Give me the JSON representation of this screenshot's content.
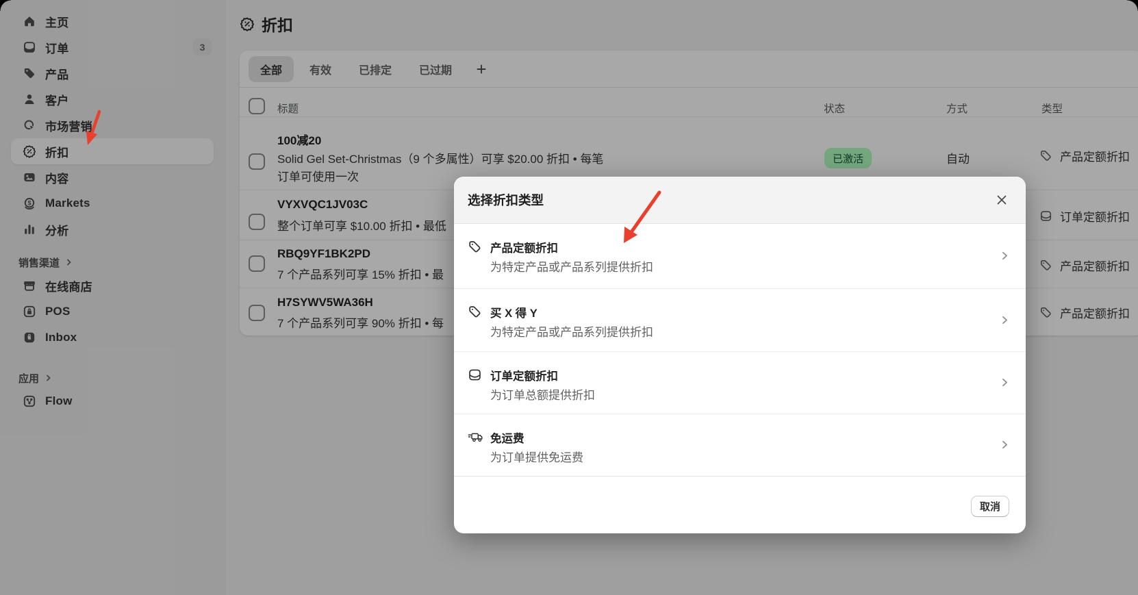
{
  "page": {
    "title": "折扣"
  },
  "sidebar": {
    "items": [
      {
        "label": "主页",
        "icon": "home-icon"
      },
      {
        "label": "订单",
        "icon": "orders-icon",
        "badge": "3"
      },
      {
        "label": "产品",
        "icon": "products-tag-icon"
      },
      {
        "label": "客户",
        "icon": "customers-icon"
      },
      {
        "label": "市场营销",
        "icon": "marketing-icon"
      },
      {
        "label": "折扣",
        "icon": "discounts-icon",
        "active": true
      },
      {
        "label": "内容",
        "icon": "content-icon"
      },
      {
        "label": "Markets",
        "icon": "markets-icon"
      },
      {
        "label": "分析",
        "icon": "analytics-icon"
      }
    ],
    "sections": [
      {
        "header": "销售渠道",
        "items": [
          {
            "label": "在线商店",
            "icon": "online-store-icon"
          },
          {
            "label": "POS",
            "icon": "pos-icon"
          },
          {
            "label": "Inbox",
            "icon": "inbox-icon"
          }
        ]
      },
      {
        "header": "应用",
        "items": [
          {
            "label": "Flow",
            "icon": "flow-icon"
          }
        ]
      }
    ]
  },
  "tabs": {
    "items": [
      "全部",
      "有效",
      "已排定",
      "已过期"
    ],
    "active": "全部",
    "add_label": "+"
  },
  "table": {
    "columns": {
      "title": "标题",
      "status": "状态",
      "method": "方式",
      "type": "类型"
    },
    "rows": [
      {
        "title": "100减20",
        "desc": "Solid Gel Set-Christmas（9 个多属性）可享 $20.00 折扣 • 每笔",
        "desc2": "订单可使用一次",
        "status": "已激活",
        "method": "自动",
        "type": "产品定额折扣",
        "type_icon": "tag-icon"
      },
      {
        "title": "VYXVQC1JV03C",
        "desc": "整个订单可享 $10.00 折扣 • 最低",
        "type": "订单定额折扣",
        "type_icon": "order-icon"
      },
      {
        "title": "RBQ9YF1BK2PD",
        "desc": "7 个产品系列可享 15% 折扣 • 最",
        "type": "产品定额折扣",
        "type_icon": "tag-icon"
      },
      {
        "title": "H7SYWV5WA36H",
        "desc": "7 个产品系列可享 90% 折扣 • 每",
        "type": "产品定额折扣",
        "type_icon": "tag-icon"
      }
    ]
  },
  "modal": {
    "title": "选择折扣类型",
    "options": [
      {
        "title": "产品定额折扣",
        "desc": "为特定产品或产品系列提供折扣",
        "icon": "tag-icon"
      },
      {
        "title": "买 X 得 Y",
        "desc": "为特定产品或产品系列提供折扣",
        "icon": "tag-icon"
      },
      {
        "title": "订单定额折扣",
        "desc": "为订单总额提供折扣",
        "icon": "order-icon"
      },
      {
        "title": "免运费",
        "desc": "为订单提供免运费",
        "icon": "truck-icon"
      }
    ],
    "cancel_label": "取消"
  },
  "colors": {
    "badge_success_bg": "#affebf",
    "badge_success_text": "#0c5132",
    "annotation_arrow": "#e8402c",
    "sidebar_bg": "#ebebeb",
    "card_bg": "#ffffff"
  }
}
